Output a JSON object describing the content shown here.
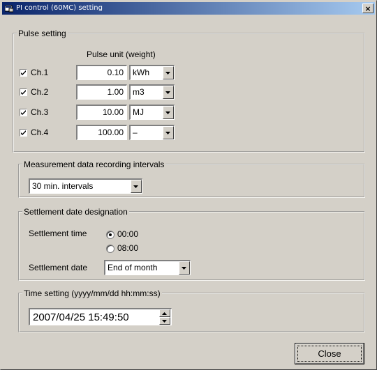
{
  "window": {
    "title": "PI control (60MC) setting",
    "close_glyph": "×"
  },
  "pulse_setting": {
    "legend": "Pulse setting",
    "header": "Pulse unit (weight)",
    "channels": [
      {
        "label": "Ch.1",
        "checked": true,
        "value": "0.10",
        "unit": "kWh"
      },
      {
        "label": "Ch.2",
        "checked": true,
        "value": "1.00",
        "unit": "m3"
      },
      {
        "label": "Ch.3",
        "checked": true,
        "value": "10.00",
        "unit": "MJ"
      },
      {
        "label": "Ch.4",
        "checked": true,
        "value": "100.00",
        "unit": "–"
      }
    ]
  },
  "recording": {
    "legend": "Measurement data recording intervals",
    "selected": "30 min. intervals"
  },
  "settlement": {
    "legend": "Settlement date designation",
    "time_label": "Settlement time",
    "time_options": [
      {
        "label": "00:00",
        "selected": true
      },
      {
        "label": "08:00",
        "selected": false
      }
    ],
    "date_label": "Settlement date",
    "date_selected": "End of month"
  },
  "time_setting": {
    "legend": "Time setting (yyyy/mm/dd  hh:mm:ss)",
    "value": "2007/04/25 15:49:50"
  },
  "footer": {
    "close_label": "Close"
  },
  "icons": {
    "title_icon": "window-app-icon",
    "dropdown": "chevron-down-icon",
    "spin_up": "spin-up-icon",
    "spin_down": "spin-down-icon",
    "check": "checkmark-icon"
  },
  "colors": {
    "face": "#d4d0c8",
    "title_start": "#0a246a",
    "title_end": "#a6caf0"
  }
}
